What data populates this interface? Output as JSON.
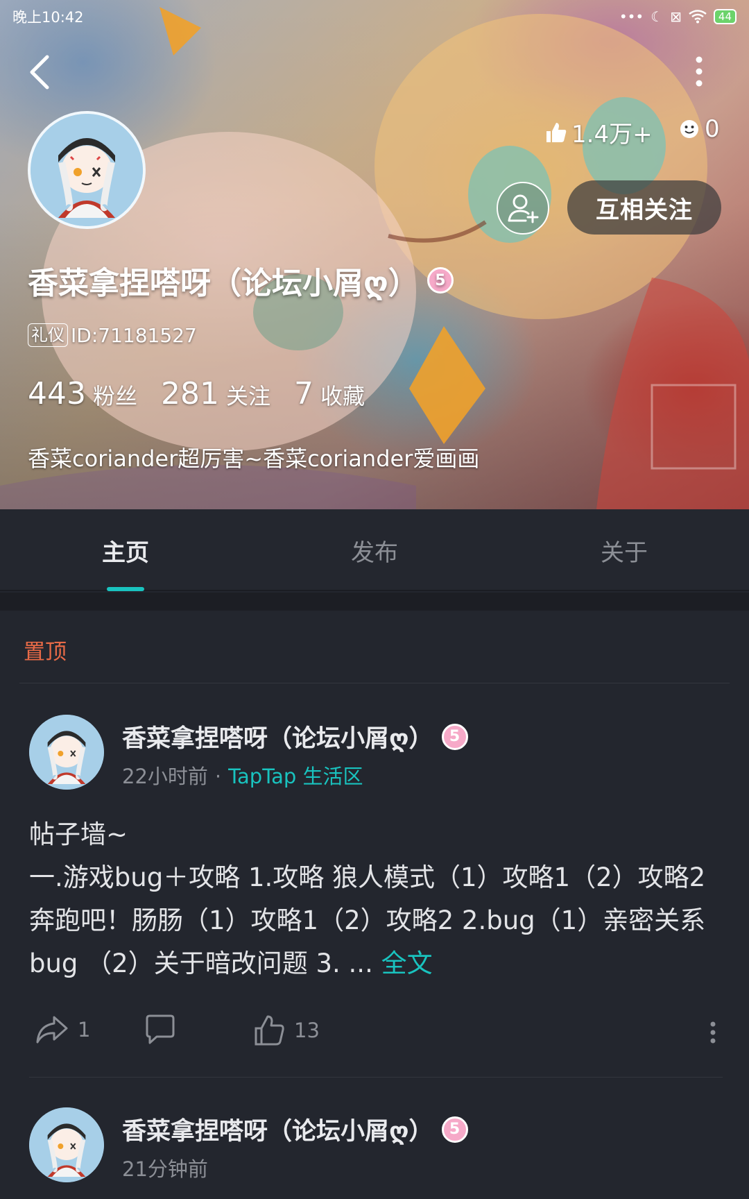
{
  "status_bar": {
    "time": "晚上10:42",
    "battery": "44",
    "icons": [
      "more-dots-icon",
      "moon-icon",
      "no-sim-icon",
      "wifi-icon",
      "battery-icon"
    ]
  },
  "header": {
    "back_icon": "back-arrow-icon",
    "more_icon": "more-vertical-icon",
    "likes_count": "1.4万+",
    "faces_count": "0",
    "follow_button": "互相关注",
    "name": "香菜拿捏嗒呀（论坛小屑ღ）",
    "level": "5",
    "etiquette_tag": "礼仪",
    "user_id": "ID:71181527",
    "followers_count": "443",
    "followers_label": "粉丝",
    "following_count": "281",
    "following_label": "关注",
    "favorites_count": "7",
    "favorites_label": "收藏",
    "bio": "香菜coriander超厉害~香菜coriander爱画画"
  },
  "tabs": [
    {
      "label": "主页",
      "active": true
    },
    {
      "label": "发布",
      "active": false
    },
    {
      "label": "关于",
      "active": false
    }
  ],
  "feed": {
    "pinned_label": "置顶",
    "posts": [
      {
        "author": "香菜拿捏嗒呀（论坛小屑ღ）",
        "level": "5",
        "time": "22小时前",
        "separator": "·",
        "forum": "TapTap 生活区",
        "title": "帖子墙~",
        "body": "一.游戏bug＋攻略 1.攻略 狼人模式（1）攻略1（2）攻略2  奔跑吧！肠肠（1）攻略1（2）攻略2 2.bug（1）亲密关系bug （2）关于暗改问题 3. ...",
        "full_text_link": "全文",
        "share_count": "1",
        "like_count": "13"
      },
      {
        "author": "香菜拿捏嗒呀（论坛小屑ღ）",
        "level": "5",
        "time": "21分钟前"
      }
    ]
  },
  "colors": {
    "accent": "#19c3bf",
    "pinned": "#e86a47",
    "background": "#23262e",
    "level_badge": "#f6a9c8"
  }
}
